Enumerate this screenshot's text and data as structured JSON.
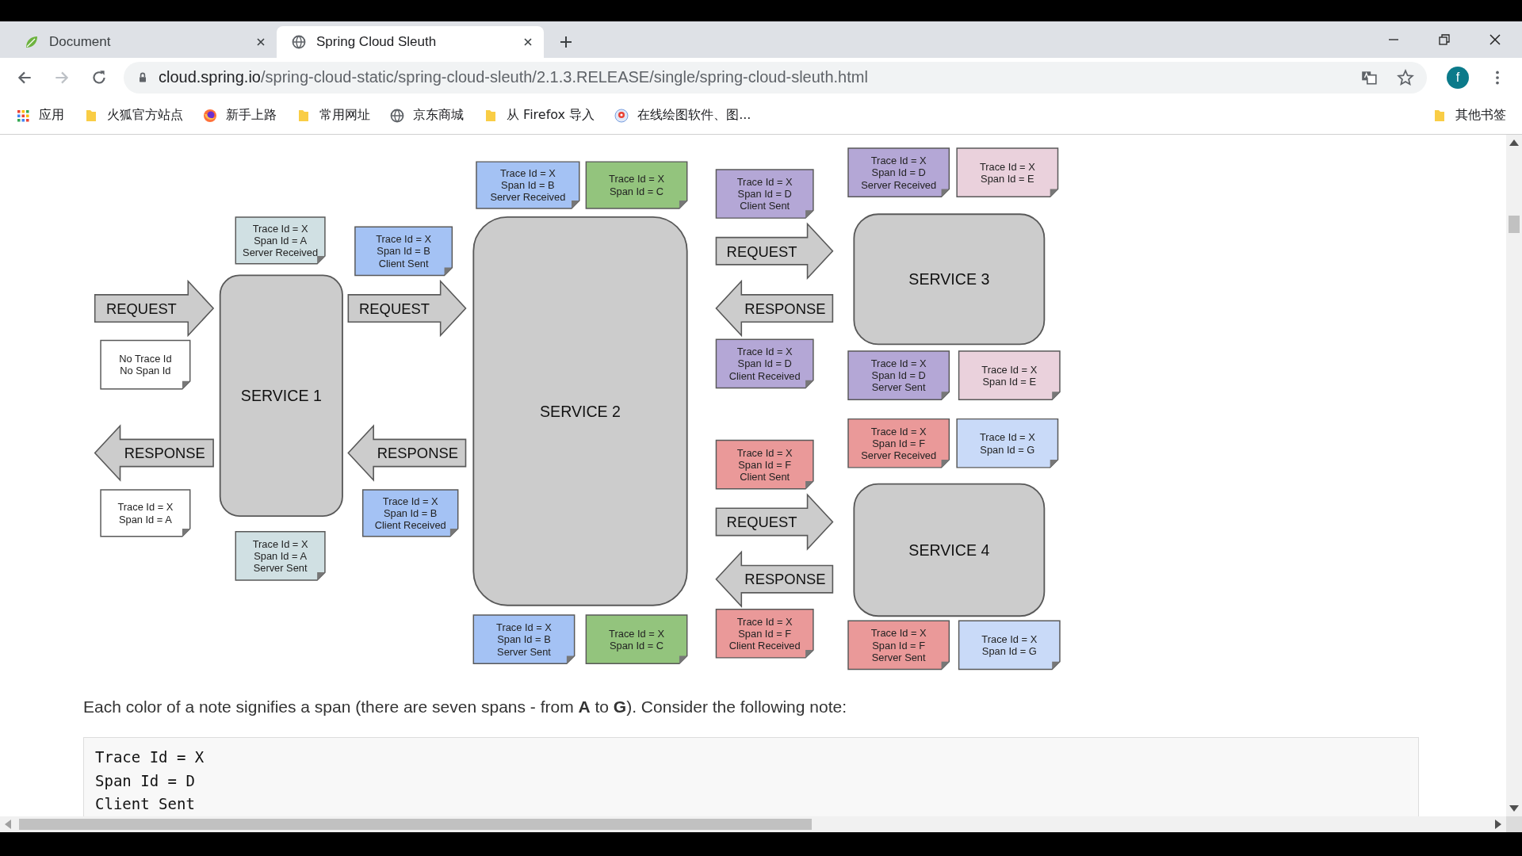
{
  "browser": {
    "tabs": [
      {
        "title": "Document",
        "kind": "leaf",
        "selected": false
      },
      {
        "title": "Spring Cloud Sleuth",
        "kind": "globe",
        "selected": true
      }
    ],
    "address": {
      "host": "cloud.spring.io",
      "path": "/spring-cloud-static/spring-cloud-sleuth/2.1.3.RELEASE/single/spring-cloud-sleuth.html"
    },
    "profile": {
      "initial": "f"
    },
    "bookmarks": [
      {
        "label": "应用",
        "kind": "apps"
      },
      {
        "label": "火狐官方站点",
        "kind": "folder"
      },
      {
        "label": "新手上路",
        "kind": "firefox"
      },
      {
        "label": "常用网址",
        "kind": "folder"
      },
      {
        "label": "京东商城",
        "kind": "globe"
      },
      {
        "label": "从 Firefox 导入",
        "kind": "folder"
      },
      {
        "label": "在线绘图软件、图...",
        "kind": "drawio"
      }
    ],
    "other_bookmarks": {
      "label": "其他书签",
      "kind": "folder"
    }
  },
  "diagram": {
    "services": [
      {
        "label": "SERVICE 1"
      },
      {
        "label": "SERVICE 2"
      },
      {
        "label": "SERVICE 3"
      },
      {
        "label": "SERVICE 4"
      }
    ],
    "arrows": [
      {
        "label": "REQUEST",
        "kind": "right"
      },
      {
        "label": "RESPONSE",
        "kind": "left"
      },
      {
        "label": "REQUEST",
        "kind": "right"
      },
      {
        "label": "RESPONSE",
        "kind": "left"
      },
      {
        "label": "REQUEST",
        "kind": "right"
      },
      {
        "label": "RESPONSE",
        "kind": "left"
      },
      {
        "label": "REQUEST",
        "kind": "right"
      },
      {
        "label": "RESPONSE",
        "kind": "left"
      }
    ],
    "notes": [
      {
        "lines": [
          "Trace Id = X",
          "Span Id = A",
          "Server Received"
        ],
        "color": "#d0e0e3"
      },
      {
        "lines": [
          "No Trace Id",
          "No Span Id"
        ],
        "color": "#ffffff"
      },
      {
        "lines": [
          "Trace Id = X",
          "Span Id = A"
        ],
        "color": "#ffffff"
      },
      {
        "lines": [
          "Trace Id = X",
          "Span Id = A",
          "Server Sent"
        ],
        "color": "#d0e0e3"
      },
      {
        "lines": [
          "Trace Id = X",
          "Span Id = B",
          "Client Sent"
        ],
        "color": "#a4c2f4"
      },
      {
        "lines": [
          "Trace Id = X",
          "Span Id = B",
          "Client Received"
        ],
        "color": "#a4c2f4"
      },
      {
        "lines": [
          "Trace Id = X",
          "Span Id = B",
          "Server Received"
        ],
        "color": "#a4c2f4"
      },
      {
        "lines": [
          "Trace Id = X",
          "Span Id = C"
        ],
        "color": "#93c47d"
      },
      {
        "lines": [
          "Trace Id = X",
          "Span Id = B",
          "Server Sent"
        ],
        "color": "#a4c2f4"
      },
      {
        "lines": [
          "Trace Id = X",
          "Span Id = C"
        ],
        "color": "#93c47d"
      },
      {
        "lines": [
          "Trace Id = X",
          "Span Id = D",
          "Client Sent"
        ],
        "color": "#b4a7d6"
      },
      {
        "lines": [
          "Trace Id = X",
          "Span Id = D",
          "Client Received"
        ],
        "color": "#b4a7d6"
      },
      {
        "lines": [
          "Trace Id = X",
          "Span Id = F",
          "Client Sent"
        ],
        "color": "#ea9999"
      },
      {
        "lines": [
          "Trace Id = X",
          "Span Id = F",
          "Client Received"
        ],
        "color": "#ea9999"
      },
      {
        "lines": [
          "Trace Id = X",
          "Span Id = D",
          "Server Received"
        ],
        "color": "#b4a7d6"
      },
      {
        "lines": [
          "Trace Id = X",
          "Span Id = E"
        ],
        "color": "#ead1dc"
      },
      {
        "lines": [
          "Trace Id = X",
          "Span Id = D",
          "Server Sent"
        ],
        "color": "#b4a7d6"
      },
      {
        "lines": [
          "Trace Id = X",
          "Span Id = E"
        ],
        "color": "#ead1dc"
      },
      {
        "lines": [
          "Trace Id = X",
          "Span Id = F",
          "Server Received"
        ],
        "color": "#ea9999"
      },
      {
        "lines": [
          "Trace Id = X",
          "Span Id = G"
        ],
        "color": "#c9daf8"
      },
      {
        "lines": [
          "Trace Id = X",
          "Span Id = F",
          "Server Sent"
        ],
        "color": "#ea9999"
      },
      {
        "lines": [
          "Trace Id = X",
          "Span Id = G"
        ],
        "color": "#c9daf8"
      }
    ]
  },
  "paragraph": "Each color of a note signifies a span (there are seven spans - from **A** to **G**). Consider the following note:",
  "code": [
    "Trace Id = X",
    "Span Id = D",
    "Client Sent"
  ]
}
